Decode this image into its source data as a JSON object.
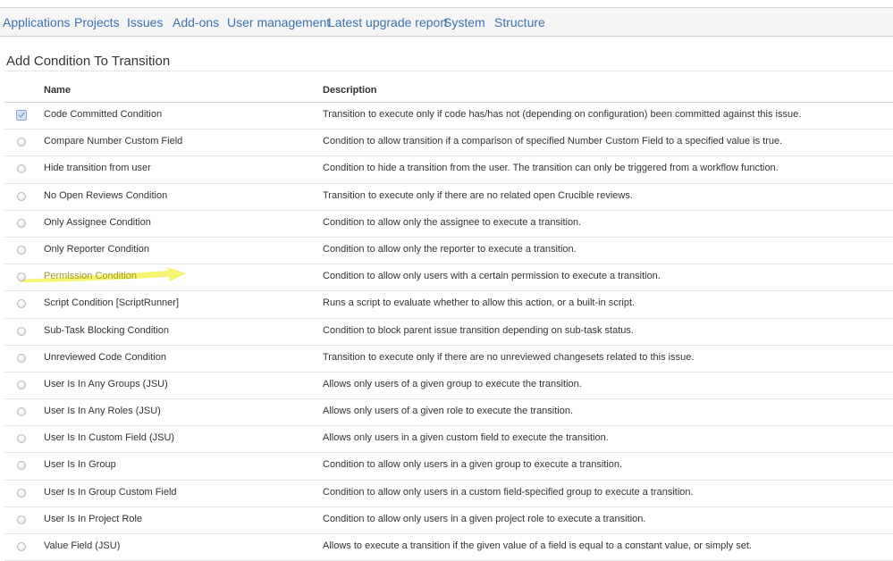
{
  "nav": {
    "items": [
      "Applications",
      "Projects",
      "Issues",
      "Add-ons",
      "User management",
      "Latest upgrade report",
      "System",
      "Structure"
    ]
  },
  "page": {
    "title": "Add Condition To Transition"
  },
  "table": {
    "columns": [
      "Name",
      "Description"
    ],
    "rows": [
      {
        "name": "Code Committed Condition",
        "description": "Transition to execute only if code has/has not (depending on configuration) been committed against this issue.",
        "selected": true
      },
      {
        "name": "Compare Number Custom Field",
        "description": "Condition to allow transition if a comparison of specified Number Custom Field to a specified value is true.",
        "selected": false
      },
      {
        "name": "Hide transition from user",
        "description": "Condition to hide a transition from the user. The transition can only be triggered from a workflow function.",
        "selected": false
      },
      {
        "name": "No Open Reviews Condition",
        "description": "Transition to execute only if there are no related open Crucible reviews.",
        "selected": false
      },
      {
        "name": "Only Assignee Condition",
        "description": "Condition to allow only the assignee to execute a transition.",
        "selected": false
      },
      {
        "name": "Only Reporter Condition",
        "description": "Condition to allow only the reporter to execute a transition.",
        "selected": false
      },
      {
        "name": "Permission Condition",
        "description": "Condition to allow only users with a certain permission to execute a transition.",
        "selected": false,
        "highlighted": true
      },
      {
        "name": "Script Condition [ScriptRunner]",
        "description": "Runs a script to evaluate whether to allow this action, or a built-in script.",
        "selected": false
      },
      {
        "name": "Sub-Task Blocking Condition",
        "description": "Condition to block parent issue transition depending on sub-task status.",
        "selected": false
      },
      {
        "name": "Unreviewed Code Condition",
        "description": "Transition to execute only if there are no unreviewed changesets related to this issue.",
        "selected": false
      },
      {
        "name": "User Is In Any Groups (JSU)",
        "description": "Allows only users of a given group to execute the transition.",
        "selected": false
      },
      {
        "name": "User Is In Any Roles (JSU)",
        "description": "Allows only users of a given role to execute the transition.",
        "selected": false
      },
      {
        "name": "User Is In Custom Field (JSU)",
        "description": "Allows only users in a given custom field to execute the transition.",
        "selected": false
      },
      {
        "name": "User Is In Group",
        "description": "Condition to allow only users in a given group to execute a transition.",
        "selected": false
      },
      {
        "name": "User Is In Group Custom Field",
        "description": "Condition to allow only users in a custom field-specified group to execute a transition.",
        "selected": false
      },
      {
        "name": "User Is In Project Role",
        "description": "Condition to allow only users in a given project role to execute a transition.",
        "selected": false
      },
      {
        "name": "Value Field (JSU)",
        "description": "Allows to execute a transition if the given value of a field is equal to a constant value, or simply set.",
        "selected": false
      }
    ]
  },
  "colors": {
    "link": "#3b73af",
    "highlighter": "#f4f25a"
  }
}
